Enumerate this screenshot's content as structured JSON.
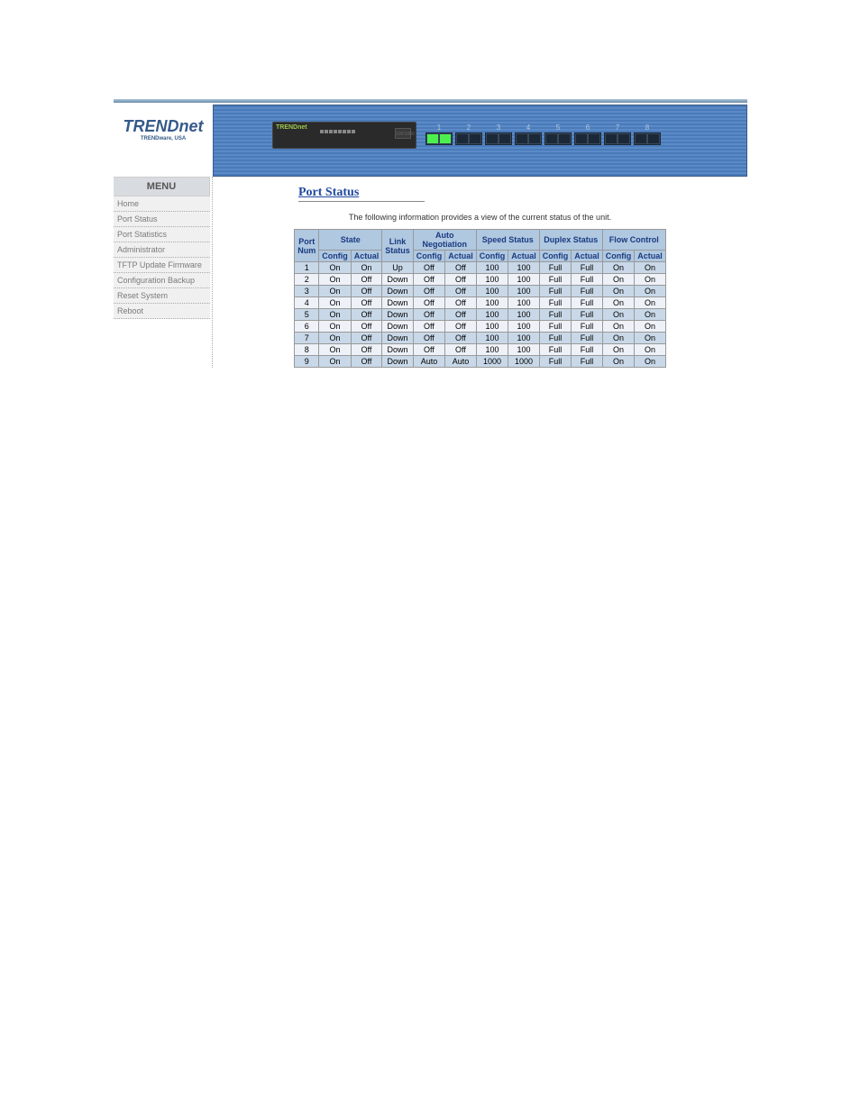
{
  "brand": {
    "name": "TRENDnet",
    "sub": "TRENDware, USA"
  },
  "banner": {
    "device_label": "TRENDnet",
    "device_info": "100/ACT\n1000 100/LINK",
    "device_screen": "100/1000",
    "port_labels": [
      "1",
      "2",
      "3",
      "4",
      "5",
      "6",
      "7",
      "8"
    ],
    "active_port": 1
  },
  "menu": {
    "title": "MENU",
    "items": [
      "Home",
      "Port Status",
      "Port Statistics",
      "Administrator",
      "TFTP Update Firmware",
      "Configuration Backup",
      "Reset System",
      "Reboot"
    ]
  },
  "content": {
    "title": "Port Status",
    "desc": "The following information provides a view of the current status of the unit.",
    "table": {
      "headers": {
        "port": "Port Num",
        "state": "State",
        "link": "Link Status",
        "auto": "Auto Negotiation",
        "speed": "Speed Status",
        "duplex": "Duplex Status",
        "flow": "Flow Control",
        "config": "Config",
        "actual": "Actual"
      },
      "rows": [
        {
          "port": "1",
          "state_c": "On",
          "state_a": "On",
          "link": "Up",
          "neg_c": "Off",
          "neg_a": "Off",
          "spd_c": "100",
          "spd_a": "100",
          "dup_c": "Full",
          "dup_a": "Full",
          "flow_c": "On",
          "flow_a": "On"
        },
        {
          "port": "2",
          "state_c": "On",
          "state_a": "Off",
          "link": "Down",
          "neg_c": "Off",
          "neg_a": "Off",
          "spd_c": "100",
          "spd_a": "100",
          "dup_c": "Full",
          "dup_a": "Full",
          "flow_c": "On",
          "flow_a": "On"
        },
        {
          "port": "3",
          "state_c": "On",
          "state_a": "Off",
          "link": "Down",
          "neg_c": "Off",
          "neg_a": "Off",
          "spd_c": "100",
          "spd_a": "100",
          "dup_c": "Full",
          "dup_a": "Full",
          "flow_c": "On",
          "flow_a": "On"
        },
        {
          "port": "4",
          "state_c": "On",
          "state_a": "Off",
          "link": "Down",
          "neg_c": "Off",
          "neg_a": "Off",
          "spd_c": "100",
          "spd_a": "100",
          "dup_c": "Full",
          "dup_a": "Full",
          "flow_c": "On",
          "flow_a": "On"
        },
        {
          "port": "5",
          "state_c": "On",
          "state_a": "Off",
          "link": "Down",
          "neg_c": "Off",
          "neg_a": "Off",
          "spd_c": "100",
          "spd_a": "100",
          "dup_c": "Full",
          "dup_a": "Full",
          "flow_c": "On",
          "flow_a": "On"
        },
        {
          "port": "6",
          "state_c": "On",
          "state_a": "Off",
          "link": "Down",
          "neg_c": "Off",
          "neg_a": "Off",
          "spd_c": "100",
          "spd_a": "100",
          "dup_c": "Full",
          "dup_a": "Full",
          "flow_c": "On",
          "flow_a": "On"
        },
        {
          "port": "7",
          "state_c": "On",
          "state_a": "Off",
          "link": "Down",
          "neg_c": "Off",
          "neg_a": "Off",
          "spd_c": "100",
          "spd_a": "100",
          "dup_c": "Full",
          "dup_a": "Full",
          "flow_c": "On",
          "flow_a": "On"
        },
        {
          "port": "8",
          "state_c": "On",
          "state_a": "Off",
          "link": "Down",
          "neg_c": "Off",
          "neg_a": "Off",
          "spd_c": "100",
          "spd_a": "100",
          "dup_c": "Full",
          "dup_a": "Full",
          "flow_c": "On",
          "flow_a": "On"
        },
        {
          "port": "9",
          "state_c": "On",
          "state_a": "Off",
          "link": "Down",
          "neg_c": "Auto",
          "neg_a": "Auto",
          "spd_c": "1000",
          "spd_a": "1000",
          "dup_c": "Full",
          "dup_a": "Full",
          "flow_c": "On",
          "flow_a": "On"
        }
      ]
    }
  }
}
